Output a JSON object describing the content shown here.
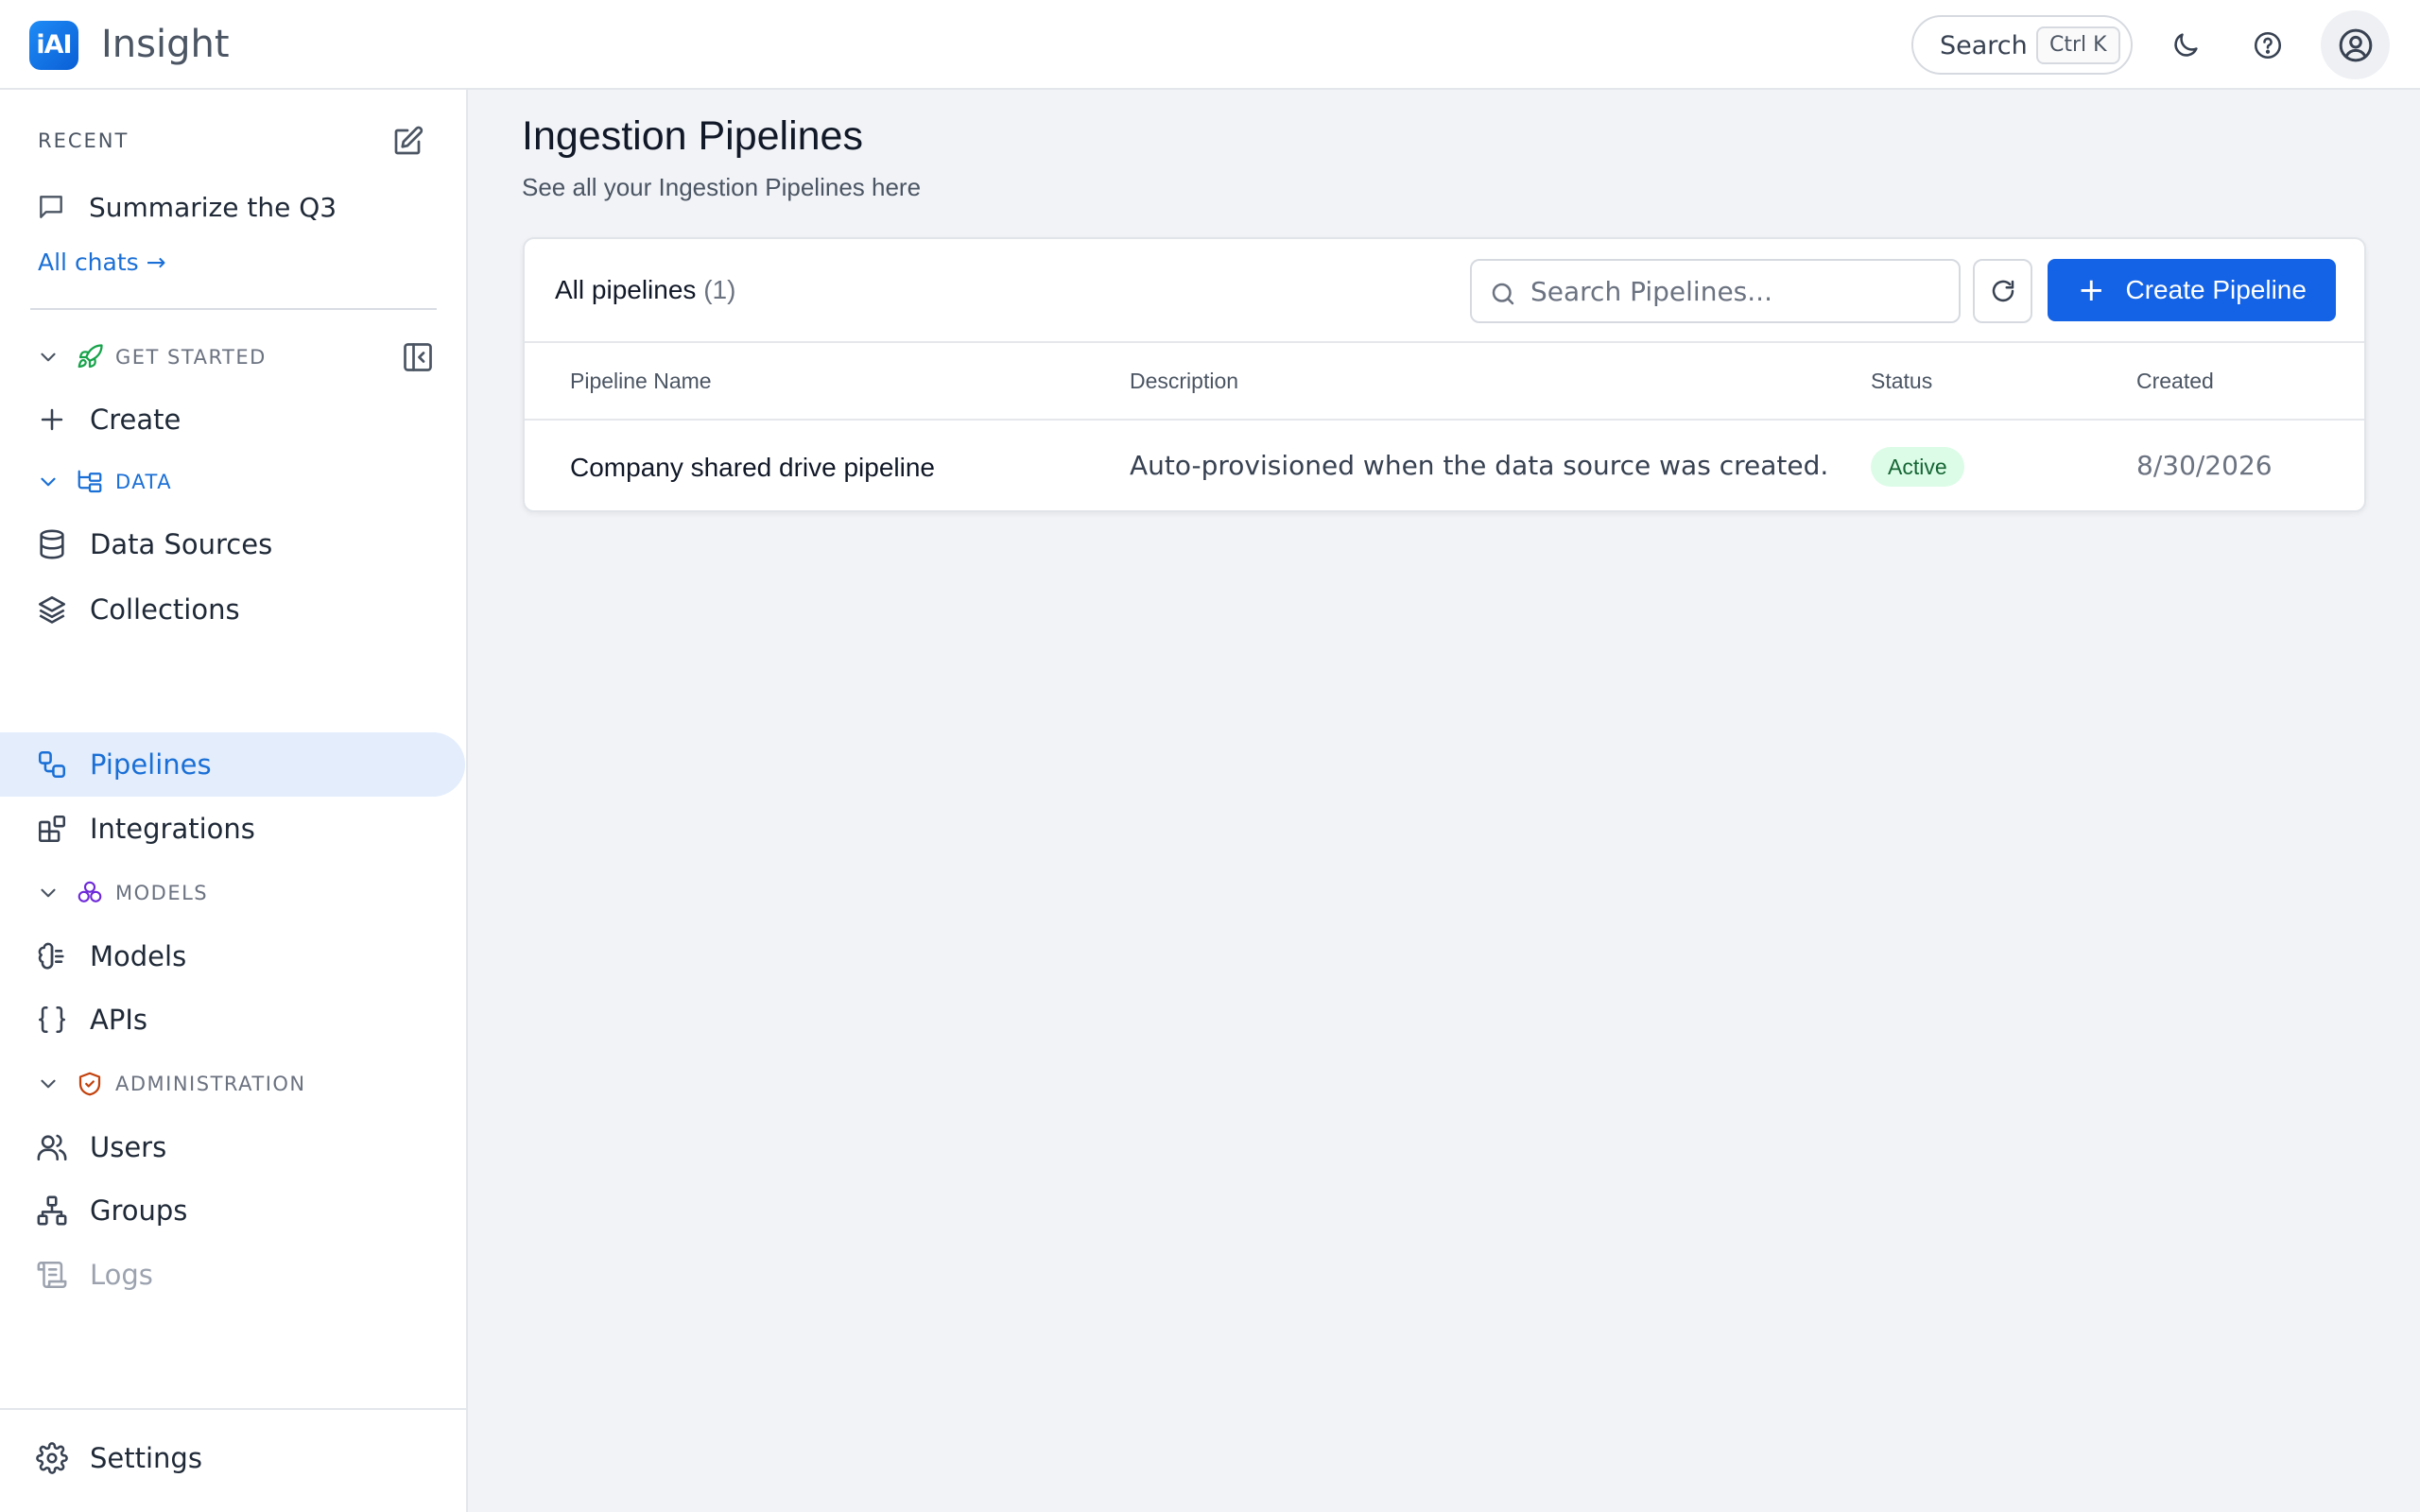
{
  "app": {
    "logo_text": "iAI",
    "title": "Insight"
  },
  "topbar": {
    "search_label": "Search",
    "search_shortcut": "Ctrl K",
    "theme_icon": "moon-icon",
    "help_icon": "help-circle-icon",
    "profile_icon": "user-circle-icon"
  },
  "sidebar": {
    "recent_header": "RECENT",
    "recent_items": [
      {
        "label": "Summarize the Q3",
        "icon": "chat-bubble-icon"
      }
    ],
    "all_chats": "All chats →",
    "sections": {
      "get_started": {
        "label": "GET STARTED",
        "items": [
          {
            "label": "Create",
            "icon": "plus-icon"
          }
        ]
      },
      "data": {
        "label": "DATA",
        "items": [
          {
            "label": "Data Sources",
            "icon": "database-icon"
          },
          {
            "label": "Collections",
            "icon": "layers-icon"
          },
          {
            "label": "Pipelines",
            "icon": "workflow-icon",
            "active": true
          },
          {
            "label": "Integrations",
            "icon": "blocks-icon"
          }
        ]
      },
      "models": {
        "label": "MODELS",
        "items": [
          {
            "label": "Models",
            "icon": "brain-icon"
          },
          {
            "label": "APIs",
            "icon": "braces-icon"
          }
        ]
      },
      "administration": {
        "label": "ADMINISTRATION",
        "items": [
          {
            "label": "Users",
            "icon": "users-icon"
          },
          {
            "label": "Groups",
            "icon": "network-icon"
          },
          {
            "label": "Logs",
            "icon": "scroll-icon",
            "disabled": true
          }
        ]
      }
    },
    "settings": "Settings"
  },
  "main": {
    "title": "Ingestion Pipelines",
    "subtitle": "See all your Ingestion Pipelines here",
    "card": {
      "title": "All pipelines",
      "count": "(1)",
      "search_placeholder": "Search Pipelines...",
      "create_label": "Create Pipeline",
      "columns": [
        "Pipeline Name",
        "Description",
        "Status",
        "Created"
      ],
      "rows": [
        {
          "name": "Company shared drive pipeline",
          "description": "Auto-provisioned when the data source was created.",
          "status": "Active",
          "created": "8/30/2026"
        }
      ]
    }
  },
  "colors": {
    "accent": "#1463e6",
    "active_bg": "#e3edfc",
    "active_text": "#1a6fd6",
    "status_active_bg": "#dcfce7",
    "status_active_text": "#166534"
  }
}
